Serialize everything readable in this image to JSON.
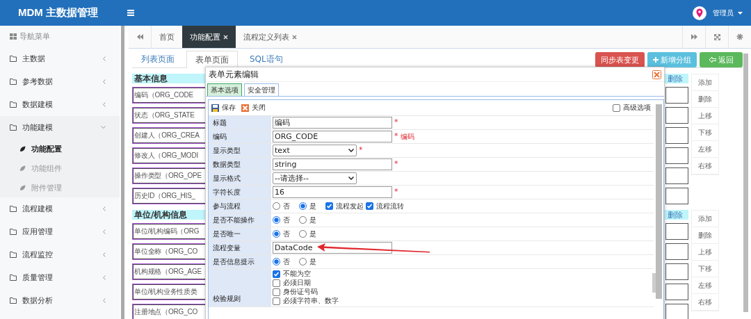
{
  "header": {
    "title": "MDM 主数据管理",
    "user": "管理员"
  },
  "sidebar": {
    "heading": "导航菜单",
    "items": [
      {
        "label": "主数据",
        "expanded": false
      },
      {
        "label": "参考数据",
        "expanded": false
      },
      {
        "label": "数据建模",
        "expanded": false
      },
      {
        "label": "功能建模",
        "expanded": true,
        "children": [
          {
            "label": "功能配置",
            "selected": true
          },
          {
            "label": "功能组件",
            "selected": false
          },
          {
            "label": "附件管理",
            "selected": false
          }
        ]
      },
      {
        "label": "流程建模",
        "expanded": false
      },
      {
        "label": "应用管理",
        "expanded": false
      },
      {
        "label": "流程监控",
        "expanded": false
      },
      {
        "label": "质量管理",
        "expanded": false
      },
      {
        "label": "数据分析",
        "expanded": false
      }
    ]
  },
  "tabs": [
    {
      "label": "首页",
      "selected": false,
      "closable": false
    },
    {
      "label": "功能配置",
      "selected": true,
      "closable": true
    },
    {
      "label": "流程定义列表",
      "selected": false,
      "closable": true
    }
  ],
  "page_tabs": [
    {
      "label": "列表页面",
      "selected": false
    },
    {
      "label": "表单页面",
      "selected": true
    },
    {
      "label": "SQL语句",
      "selected": false
    }
  ],
  "actions": [
    {
      "label": "同步表变更",
      "kind": "danger"
    },
    {
      "label": "新增分组",
      "kind": "add"
    },
    {
      "label": "返回",
      "kind": "back"
    }
  ],
  "groups": [
    {
      "title": "基本信息",
      "delete": "删除",
      "fields": [
        "编码（ORG_CODE",
        "状态（ORG_STATE",
        "创建人（ORG_CREA",
        "修改人（ORG_MODI",
        "操作类型（ORG_OPE",
        "历史ID（ORG_HIS_"
      ],
      "buttons": [
        "添加",
        "删除",
        "上移",
        "下移",
        "左移",
        "右移"
      ]
    },
    {
      "title": "单位/机构信息",
      "delete": "删除",
      "fields": [
        "单位/机构编码（ORG",
        "单位全称（ORG_CO",
        "机构规格（ORG_AGE",
        "单位/机构业务性质类",
        "注册地点（ORG_CO"
      ],
      "buttons": [
        "添加",
        "删除",
        "上移",
        "下移",
        "左移",
        "右移"
      ]
    }
  ],
  "dialog": {
    "title": "表单元素编辑",
    "tabs": [
      {
        "label": "基本选项",
        "selected": true
      },
      {
        "label": "安全管理",
        "selected": false
      }
    ],
    "toolbar": {
      "save": "保存",
      "close": "关闭",
      "advanced": {
        "label": "高级选项",
        "checked": false
      }
    },
    "rows": [
      {
        "label": "标题",
        "kind": "input",
        "value": "编码",
        "mark": "*"
      },
      {
        "label": "编码",
        "kind": "input",
        "value": "ORG_CODE",
        "mark": "*",
        "note": "编码"
      },
      {
        "label": "显示类型",
        "kind": "select",
        "value": "text",
        "mark": "*"
      },
      {
        "label": "数据类型",
        "kind": "input",
        "value": "string",
        "mark": "*"
      },
      {
        "label": "显示格式",
        "kind": "select",
        "value": "--请选择--"
      },
      {
        "label": "字符长度",
        "kind": "input",
        "value": "16",
        "mark": "*"
      },
      {
        "label": "参与流程",
        "kind": "radio",
        "options": [
          {
            "label": "否",
            "selected": false
          },
          {
            "label": "是",
            "selected": true
          }
        ],
        "checks": [
          {
            "label": "流程发起",
            "checked": true
          },
          {
            "label": "流程流转",
            "checked": true
          }
        ]
      },
      {
        "label": "是否不能操作",
        "kind": "radio",
        "options": [
          {
            "label": "否",
            "selected": true
          },
          {
            "label": "是",
            "selected": false
          }
        ]
      },
      {
        "label": "是否唯一",
        "kind": "radio",
        "options": [
          {
            "label": "否",
            "selected": true
          },
          {
            "label": "是",
            "selected": false
          }
        ]
      },
      {
        "label": "流程变量",
        "kind": "input",
        "value": "DataCode",
        "arrow": true
      },
      {
        "label": "是否信息提示",
        "kind": "radio",
        "options": [
          {
            "label": "否",
            "selected": true
          },
          {
            "label": "是",
            "selected": false
          }
        ]
      },
      {
        "label": "校验规则",
        "kind": "checklist",
        "checks": [
          {
            "label": "不能为空",
            "checked": true
          },
          {
            "label": "必须日期",
            "checked": false
          },
          {
            "label": "身份证号码",
            "checked": false
          },
          {
            "label": "必须字符串、数字",
            "checked": false
          }
        ]
      }
    ]
  }
}
